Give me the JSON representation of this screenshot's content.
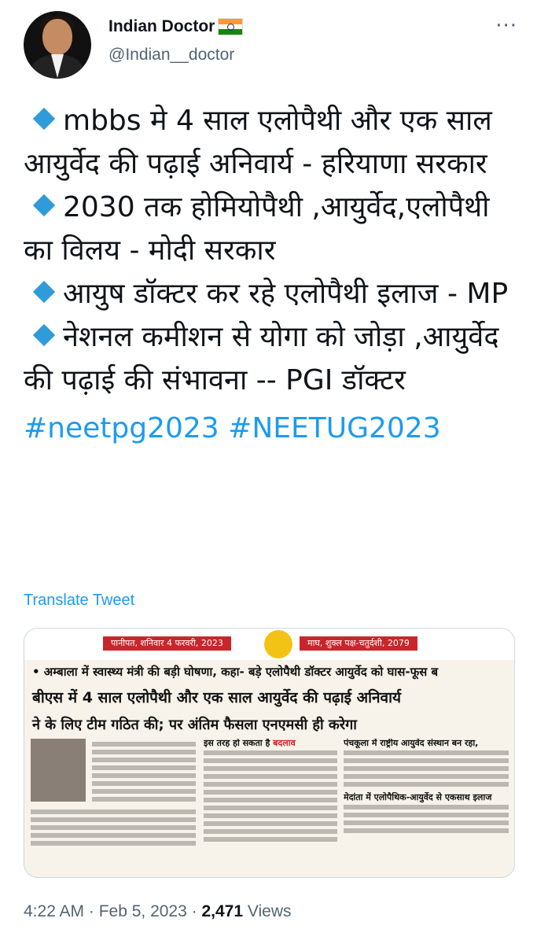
{
  "author": {
    "name": "Indian Doctor",
    "handle": "@Indian__doctor",
    "flag_icon": "india-flag-icon"
  },
  "tweet": {
    "lines": [
      "mbbs मे 4 साल एलोपैथी और एक साल आयुर्वेद की पढ़ाई अनिवार्य - हरियाणा सरकार",
      "2030 तक होमियोपैथी ,आयुर्वेद,एलोपैथी का विलय - मोदी सरकार",
      "आयुष डॉक्टर कर रहे एलोपैथी इलाज - MP",
      "नेशनल कमीशन से योगा को जोड़ा ,आयुर्वेद की पढ़ाई की संभावना -- PGI डॉक्टर"
    ],
    "hashtags": "#neetpg2023 #NEETUG2023",
    "translate_label": "Translate Tweet"
  },
  "newspaper": {
    "dateline_left": "पानीपत, शनिवार 4 फरवरी, 2023",
    "dateline_right": "माघ, शुक्ल पक्ष-चतुर्दशी, 2079",
    "headline1": "• अम्बाला में स्वास्थ्य मंत्री की बड़ी घोषणा, कहा- बड़े एलोपैथी डॉक्टर आयुर्वेद को घास-फूस ब",
    "headline2": "बीएस में 4 साल एलोपैथी और एक साल आयुर्वेद की पढ़ाई अनिवार्य",
    "headline3": "ने के लिए टीम गठित की; पर अंतिम फैसला एनएमसी ही करेगा",
    "col2_head_a": "इस तरह हो सकता है",
    "col2_head_b": "बदलाव",
    "col3_head": "पंचकूला में राष्ट्रीय आयुर्वेद संस्थान बन रहा,",
    "col3_sub": "मेदांता में एलोपैथिक-आयुर्वेद से एकसाथ इलाज"
  },
  "meta": {
    "time": "4:22 AM · Feb 5, 2023 · ",
    "views_count": "2,471",
    "views_label": " Views"
  },
  "colors": {
    "accent": "#1d9bf0",
    "bullet": "#2f9bd9",
    "muted": "#536471"
  }
}
